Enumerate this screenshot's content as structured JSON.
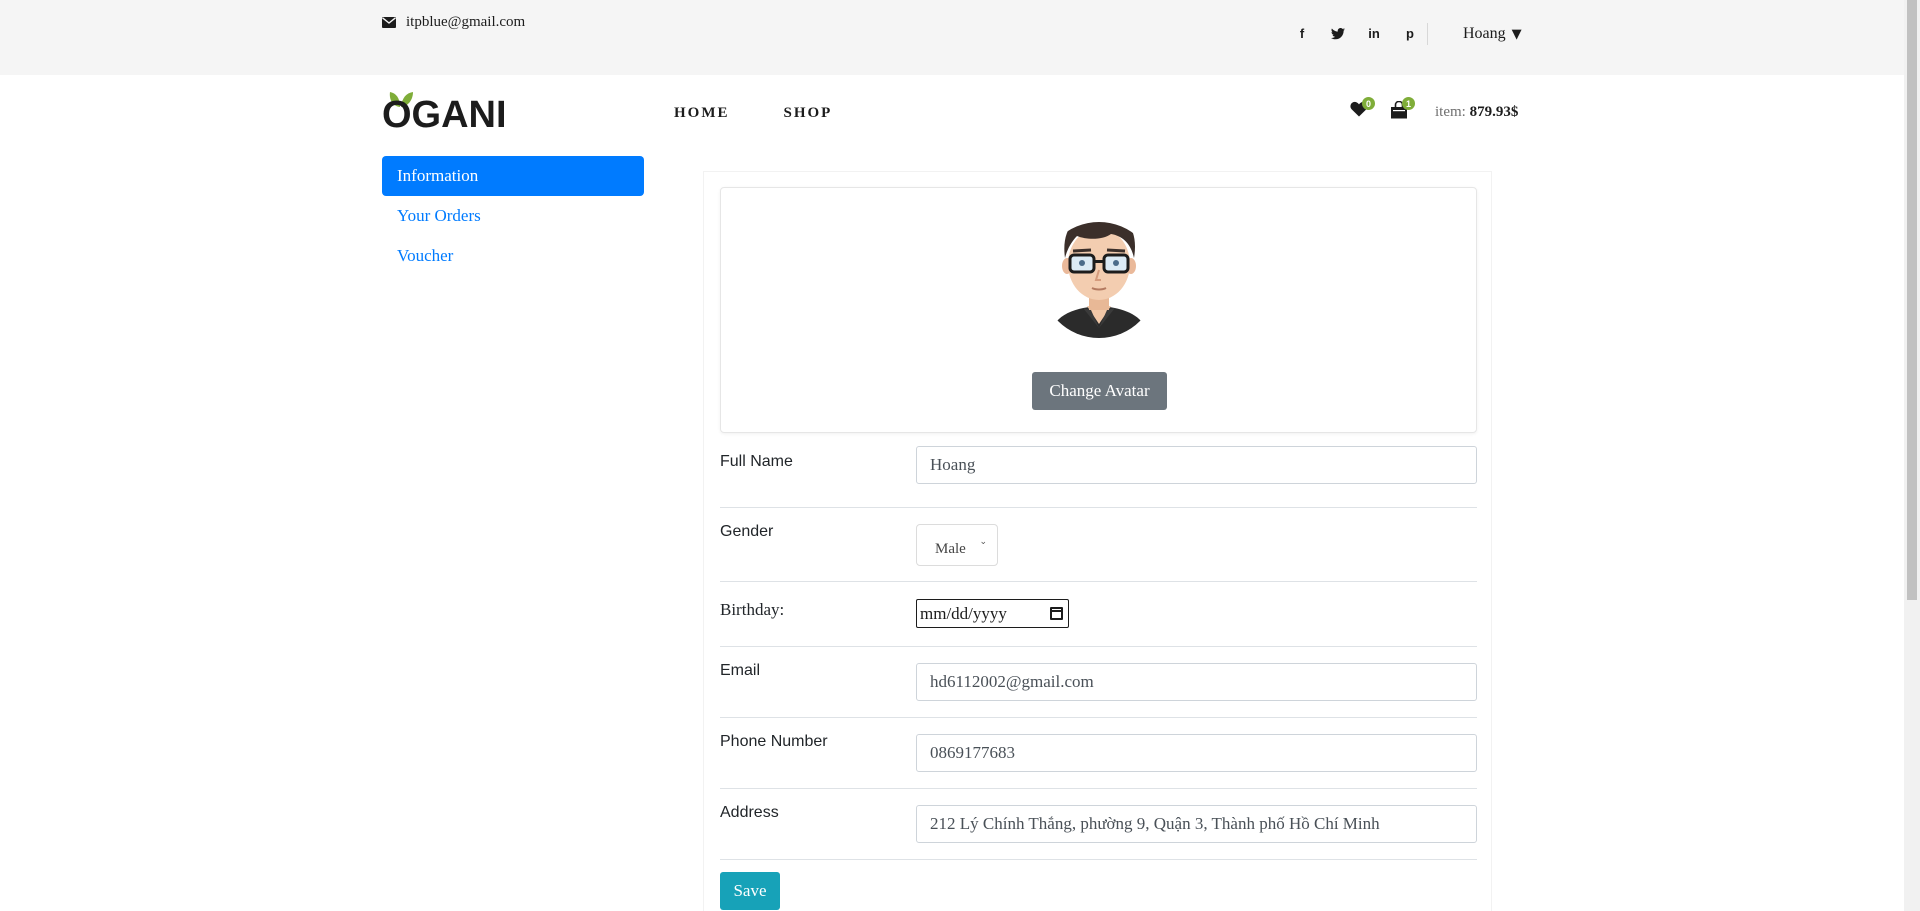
{
  "topbar": {
    "email": "itpblue@gmail.com",
    "social": [
      "f",
      "t",
      "in",
      "p"
    ],
    "user_name": "Hoang",
    "user_caret": "▼"
  },
  "header": {
    "logo_text": "OGANI",
    "nav": [
      "HOME",
      "SHOP"
    ],
    "wishlist_count": "0",
    "cart_count": "1",
    "cart_label": "item:",
    "cart_total": "879.93$"
  },
  "sidebar": {
    "items": [
      {
        "label": "Information",
        "active": true
      },
      {
        "label": "Your Orders",
        "active": false
      },
      {
        "label": "Voucher",
        "active": false
      }
    ]
  },
  "profile": {
    "change_avatar_label": "Change Avatar",
    "full_name_label": "Full Name",
    "full_name_value": "Hoang",
    "gender_label": "Gender",
    "gender_value": "Male",
    "birthday_label": "Birthday:",
    "birthday_placeholder": "mm/dd/yyyy",
    "email_label": "Email",
    "email_value": "hd6112002@gmail.com",
    "phone_label": "Phone Number",
    "phone_value": "0869177683",
    "address_label": "Address",
    "address_value": "212 Lý Chính Thắng, phường 9, Quận 3, Thành phố Hồ Chí Minh",
    "save_label": "Save"
  },
  "colors": {
    "primary": "#007bff",
    "brand_green": "#7fad39",
    "secondary_button": "#6c757d",
    "save_button": "#17a2b8"
  }
}
